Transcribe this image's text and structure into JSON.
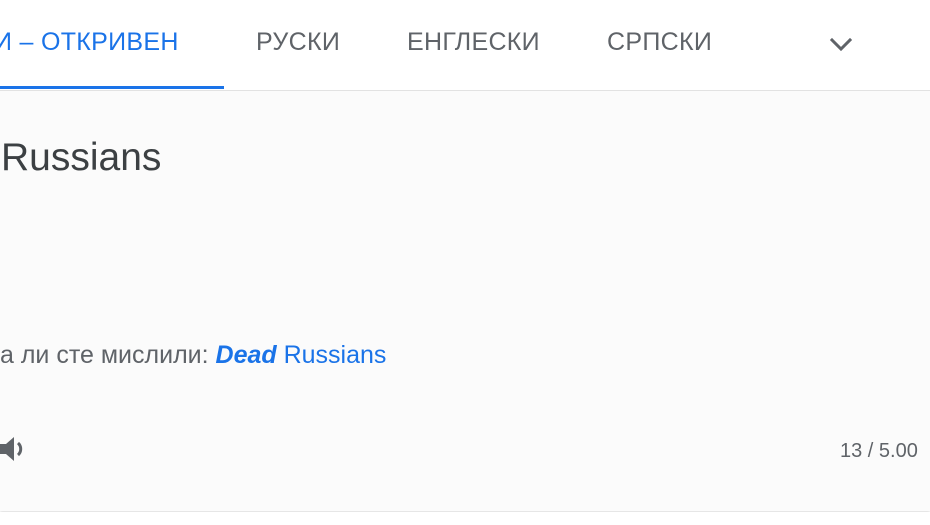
{
  "tabs": [
    {
      "label": "И – ОТКРИВЕН",
      "active": true
    },
    {
      "label": "РУСКИ",
      "active": false
    },
    {
      "label": "ЕНГЛЕСКИ",
      "active": false
    },
    {
      "label": "СРПСКИ",
      "active": false
    }
  ],
  "more_languages_icon": "chevron-down-icon",
  "source": {
    "text": "Russians"
  },
  "suggestion": {
    "prefix": "а ли сте мислили: ",
    "emphasized": "Dead",
    "rest": " Russians"
  },
  "listen_icon": "speaker-icon",
  "char_counter": "13 / 5.00",
  "colors": {
    "accent": "#1a73e8",
    "text": "#3c4043",
    "muted": "#5f6368"
  }
}
